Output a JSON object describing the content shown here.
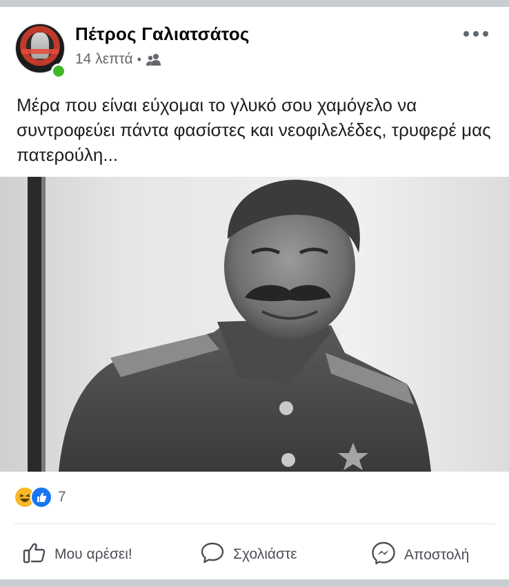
{
  "post": {
    "author": "Πέτρος Γαλιατσάτος",
    "timestamp": "14 λεπτά",
    "separator": "•",
    "audience_icon": "friends-icon",
    "more_icon": "more-options-icon",
    "text": "Μέρα που είναι εύχομαι το γλυκό σου χαμόγελο να συντροφεύει πάντα φασίστες και νεοφιλελέδες, τρυφερέ μας πατερούλη..."
  },
  "reactions": {
    "types": [
      "haha",
      "like"
    ],
    "count": "7"
  },
  "actions": {
    "like_label": "Μου αρέσει!",
    "comment_label": "Σχολιάστε",
    "send_label": "Αποστολή"
  },
  "colors": {
    "background": "#c9ccd1",
    "card": "#ffffff",
    "text": "#1c1e21",
    "secondary": "#65676b",
    "like_blue": "#1877f2",
    "online_green": "#42b72a"
  }
}
